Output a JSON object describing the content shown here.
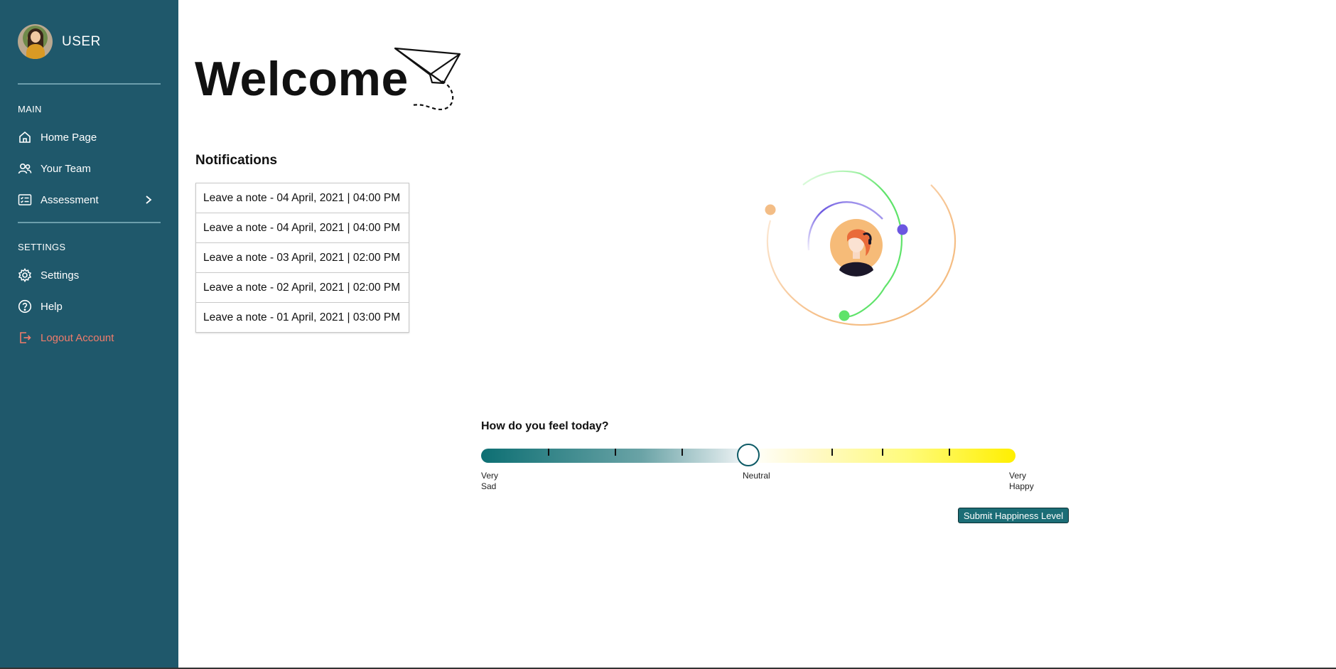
{
  "sidebar": {
    "user_name": "USER",
    "main_label": "MAIN",
    "settings_label": "SETTINGS",
    "items": [
      {
        "label": "Home Page",
        "icon": "home-icon"
      },
      {
        "label": "Your Team",
        "icon": "team-icon"
      },
      {
        "label": "Assessment",
        "icon": "assessment-icon"
      },
      {
        "label": "Settings",
        "icon": "gear-icon"
      },
      {
        "label": "Help",
        "icon": "help-icon"
      },
      {
        "label": "Logout Account",
        "icon": "logout-icon"
      }
    ]
  },
  "main": {
    "welcome": "Welcome",
    "notifications_title": "Notifications",
    "notifications": [
      "Leave a note - 04 April, 2021 | 04:00 PM",
      "Leave a note - 04 April, 2021 | 04:00 PM",
      "Leave a note - 03 April, 2021 | 02:00 PM",
      "Leave a note - 02 April, 2021 | 02:00 PM",
      "Leave a note - 01 April, 2021 | 03:00 PM"
    ]
  },
  "mood": {
    "question": "How do you feel today?",
    "value_fraction": 0.5,
    "left_label_1": "Very",
    "left_label_2": "Sad",
    "mid_label": "Neutral",
    "right_label_1": "Very",
    "right_label_2": "Happy",
    "submit_label": "Submit Happiness Level"
  },
  "colors": {
    "sidebar": "#1f586b",
    "logout": "#f17c6b",
    "accent": "#1b6d76"
  }
}
